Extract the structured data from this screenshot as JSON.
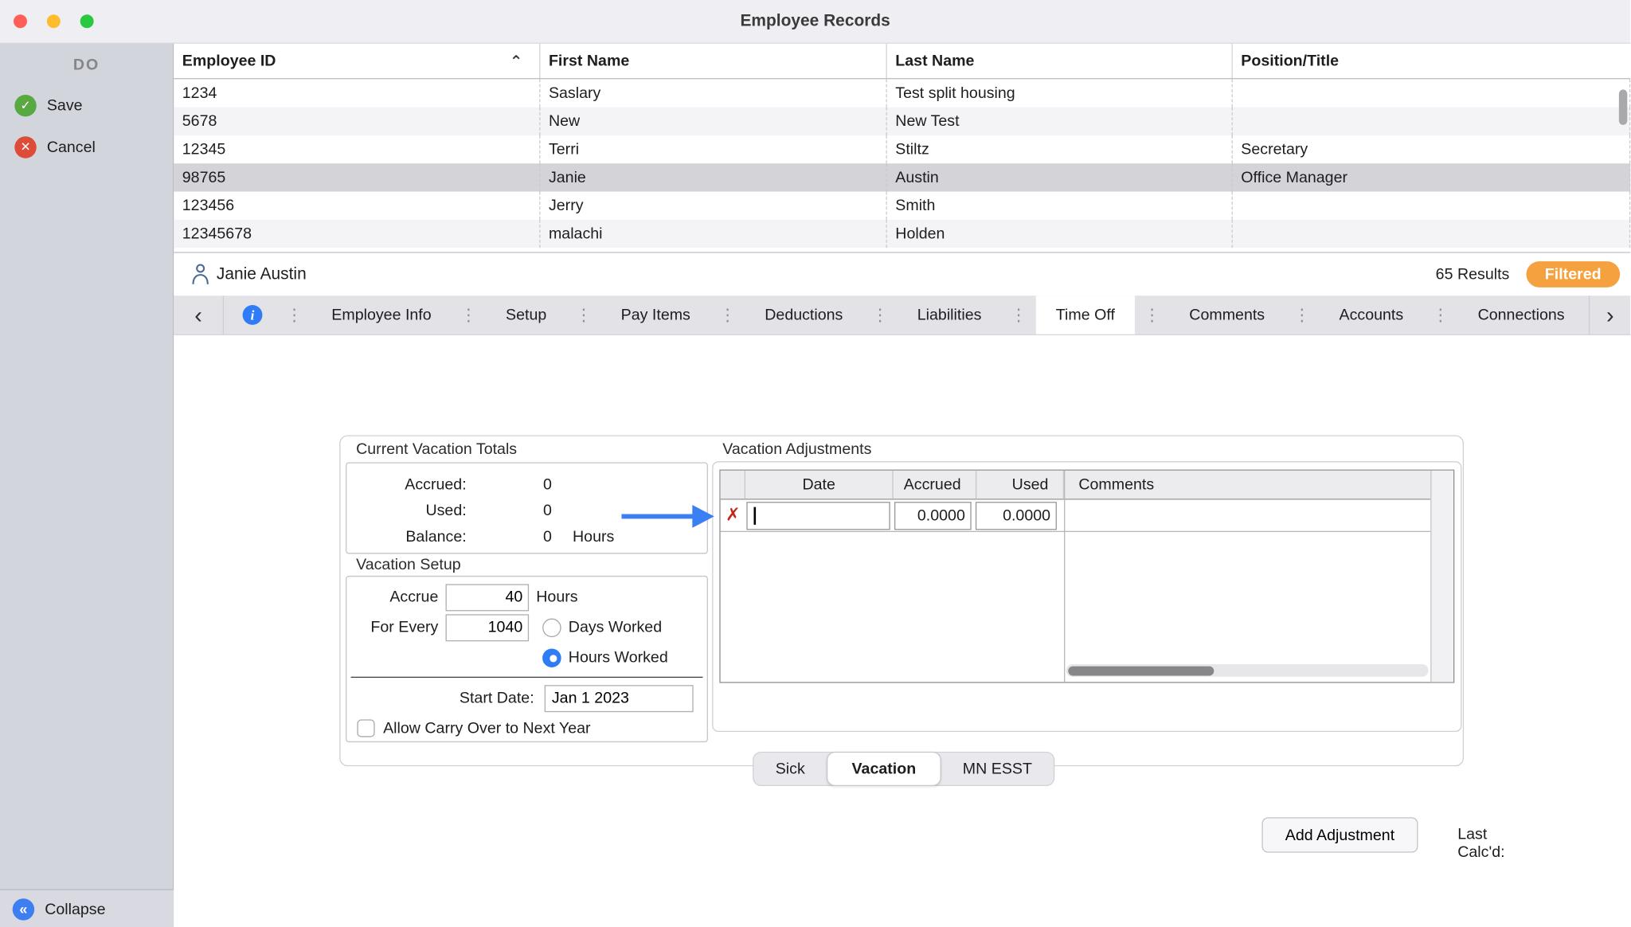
{
  "window": {
    "title": "Employee Records"
  },
  "colors": {
    "accent_blue": "#2E7CF6",
    "badge_orange": "#F6A13F",
    "save_green": "#58A942",
    "cancel_red": "#DD4B39",
    "selected_row": "#D3D3D8",
    "annotation_arrow": "#3B7FF5",
    "delete_red": "#C3271B"
  },
  "icons": {
    "check": "✓",
    "cross": "✕",
    "collapse_chevrons": "«",
    "sort_ascending": "⌃",
    "chevron_left": "‹",
    "chevron_right": "›",
    "info": "i",
    "tab_handle": "⋮",
    "delete_cross": "✗"
  },
  "sidebar": {
    "header": "DO",
    "save_label": "Save",
    "cancel_label": "Cancel",
    "collapse_label": "Collapse"
  },
  "table": {
    "columns": [
      "Employee ID",
      "First Name",
      "Last Name",
      "Position/Title"
    ],
    "sort": "Employee ID ascending",
    "rows": [
      {
        "id": "1234",
        "first": "Saslary",
        "last": "Test split housing",
        "position": ""
      },
      {
        "id": "5678",
        "first": "New",
        "last": "New Test",
        "position": ""
      },
      {
        "id": "12345",
        "first": "Terri",
        "last": "Stiltz",
        "position": "Secretary"
      },
      {
        "id": "98765",
        "first": "Janie",
        "last": "Austin",
        "position": "Office Manager"
      },
      {
        "id": "123456",
        "first": "Jerry",
        "last": "Smith",
        "position": ""
      },
      {
        "id": "12345678",
        "first": "malachi",
        "last": "Holden",
        "position": ""
      }
    ],
    "selected_row_id": "98765"
  },
  "record_bar": {
    "name": "Janie Austin",
    "results": "65 Results",
    "badge": "Filtered"
  },
  "tab_bar": {
    "tabs": [
      "Employee Info",
      "Setup",
      "Pay Items",
      "Deductions",
      "Liabilities",
      "Time Off",
      "Comments",
      "Accounts",
      "Connections"
    ],
    "selected": "Time Off"
  },
  "panel": {
    "totals": {
      "title": "Current Vacation Totals",
      "accrued_label": "Accrued:",
      "accrued_value": "0",
      "used_label": "Used:",
      "used_value": "0",
      "balance_label": "Balance:",
      "balance_value": "0",
      "unit": "Hours"
    },
    "setup": {
      "title": "Vacation Setup",
      "accrue_label": "Accrue",
      "accrue_value": "40",
      "accrue_unit": "Hours",
      "for_every_label": "For Every",
      "for_every_value": "1040",
      "days_worked": "Days Worked",
      "hours_worked": "Hours Worked",
      "selected_radio": "Hours Worked",
      "start_date_label": "Start Date:",
      "start_date_value": "Jan 1 2023",
      "carry_over": "Allow Carry Over to Next Year",
      "carry_over_checked": false
    },
    "adjustments": {
      "title": "Vacation Adjustments",
      "columns": [
        "Date",
        "Accrued",
        "Used",
        "Comments"
      ],
      "row": {
        "date": "",
        "accrued": "0.0000",
        "used": "0.0000",
        "comments": ""
      },
      "add_button": "Add Adjustment",
      "last_calcd": "Last Calc'd:"
    },
    "page_tabs": {
      "items": [
        "Sick",
        "Vacation",
        "MN ESST"
      ],
      "selected": "Vacation"
    }
  }
}
